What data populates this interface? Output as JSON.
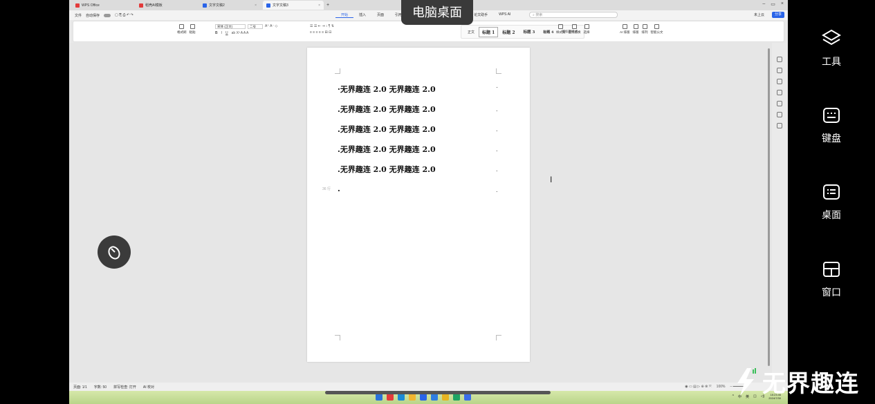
{
  "overlay": {
    "title": "电脑桌面"
  },
  "tabs": [
    {
      "label": "WPS Office",
      "color": "#e33b3b"
    },
    {
      "label": "稻壳AI模板",
      "color": "#e33b3b"
    },
    {
      "label": "文字文稿2",
      "color": "#2a64e8"
    },
    {
      "label": "文字文稿3",
      "color": "#2a64e8",
      "active": true
    }
  ],
  "menu": {
    "file": "文件",
    "autosave": "自动保存",
    "tabs": [
      "开始",
      "插入",
      "页面",
      "引用",
      "审阅",
      "视图",
      "工具",
      "会员专享",
      "论文助手",
      "WPS AI"
    ],
    "search_placeholder": "搜索",
    "collab": "未上云",
    "share": "分享"
  },
  "ribbon": {
    "format_painter": "格式刷",
    "paste": "粘贴",
    "font_name": "宋体 (正文)",
    "font_size": "二号",
    "styles": [
      "正文",
      "标题 1",
      "标题 2",
      "标题 3",
      "标题 4",
      "新标题样式"
    ],
    "style_set": "样式集",
    "find_replace": "查找替换",
    "select": "选择",
    "ai_layout": "AI 排版",
    "arrange": "排版",
    "rows": "排列",
    "smart_doc": "智能公文"
  },
  "document": {
    "lines": [
      "·无界趣连 2.0 无界趣连 2.0",
      ".无界趣连 2.0 无界趣连 2.0",
      ".无界趣连 2.0 无界趣连 2.0",
      ".无界趣连 2.0 无界趣连 2.0",
      ".无界趣连 2.0 无界趣连 2.0"
    ],
    "empty_line": ".",
    "row_label": "36 行"
  },
  "status": {
    "page": "页面: 1/1",
    "words": "字数: 50",
    "spell": "拼写检查: 打开",
    "ai": "AI 校对",
    "zoom": "100%"
  },
  "tray": {
    "time": "18:23:46",
    "date": "2024/7/30",
    "ime": "中",
    "lang": "英"
  },
  "side_panel": [
    {
      "label": "工具",
      "icon": "layers-icon"
    },
    {
      "label": "键盘",
      "icon": "keyboard-icon"
    },
    {
      "label": "桌面",
      "icon": "desktop-icon"
    },
    {
      "label": "窗口",
      "icon": "window-icon"
    }
  ],
  "brand": {
    "text": "无界趣连"
  },
  "colors": {
    "accent": "#2a64e8",
    "wps_red": "#e33b3b",
    "panel_bg": "#000000"
  }
}
